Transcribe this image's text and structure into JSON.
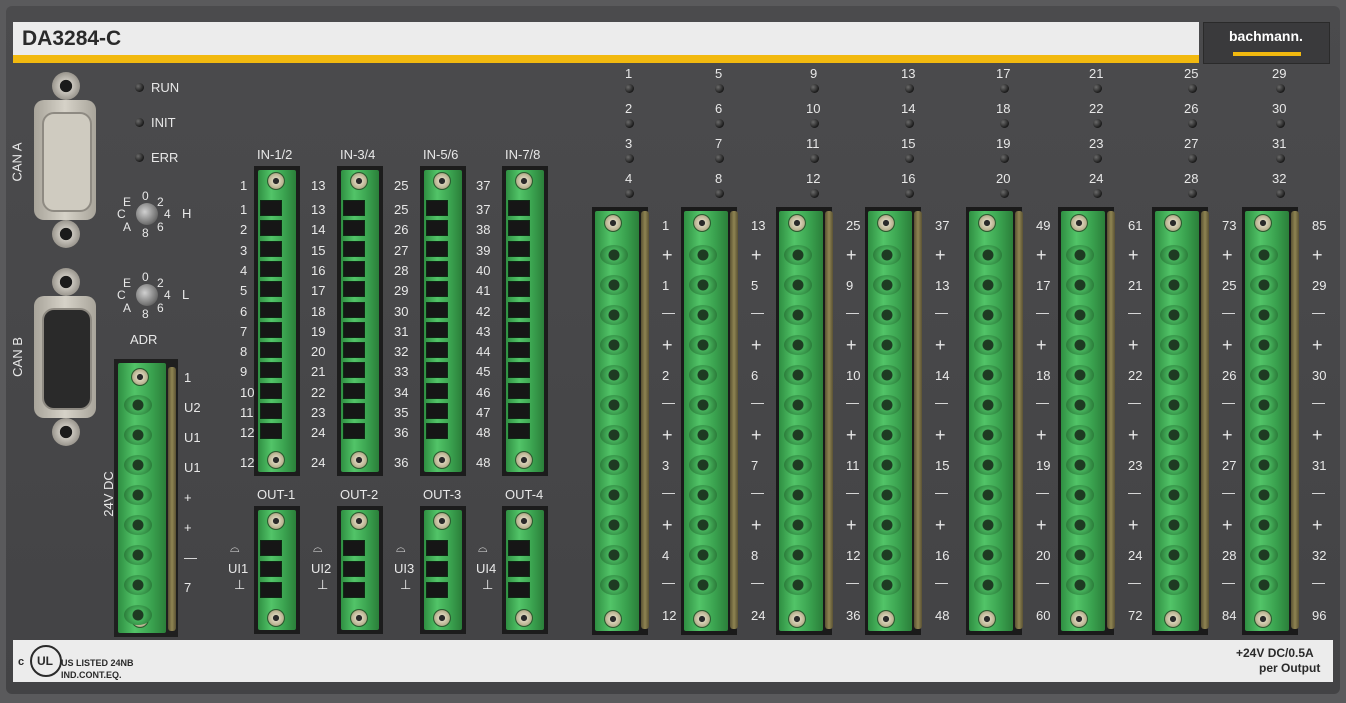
{
  "module": {
    "model": "DA3284-C",
    "brand": "bachmann.",
    "colors": {
      "accent": "#f2b90f",
      "panel": "#4a4a4c",
      "terminal": "#4dbf63",
      "label_bar": "#ececec"
    }
  },
  "status_leds": [
    "RUN",
    "INIT",
    "ERR"
  ],
  "can": {
    "a_label": "CAN A",
    "b_label": "CAN B"
  },
  "address": {
    "switch_h": {
      "top": "0",
      "right_top": "2",
      "right": "4",
      "right_bottom": "6",
      "bottom": "8",
      "left_bottom": "A",
      "left": "C",
      "left_top": "E",
      "side": "H"
    },
    "switch_l": {
      "top": "0",
      "right_top": "2",
      "right": "4",
      "right_bottom": "6",
      "bottom": "8",
      "left_bottom": "A",
      "left": "C",
      "left_top": "E",
      "side": "L"
    },
    "label": "ADR"
  },
  "power": {
    "label": "24V DC",
    "pins": [
      "1",
      "U2",
      "U1",
      "U1",
      "+",
      "+",
      "—",
      "7"
    ]
  },
  "input_groups": [
    {
      "label": "IN-1/2",
      "top": "1",
      "pins": [
        "1",
        "2",
        "3",
        "4",
        "5",
        "6",
        "7",
        "8",
        "9",
        "10",
        "11",
        "12"
      ],
      "bottom": "12"
    },
    {
      "label": "IN-3/4",
      "top": "13",
      "pins": [
        "13",
        "14",
        "15",
        "16",
        "17",
        "18",
        "19",
        "20",
        "21",
        "22",
        "23",
        "24"
      ],
      "bottom": "24"
    },
    {
      "label": "IN-5/6",
      "top": "25",
      "pins": [
        "25",
        "26",
        "27",
        "28",
        "29",
        "30",
        "31",
        "32",
        "33",
        "34",
        "35",
        "36"
      ],
      "bottom": "36"
    },
    {
      "label": "IN-7/8",
      "top": "37",
      "pins": [
        "37",
        "38",
        "39",
        "40",
        "41",
        "42",
        "43",
        "44",
        "45",
        "46",
        "47",
        "48"
      ],
      "bottom": "48"
    }
  ],
  "output_groups": [
    {
      "label": "OUT-1",
      "ui": "UI1",
      "ground": "⊥"
    },
    {
      "label": "OUT-2",
      "ui": "UI2",
      "ground": "⊥"
    },
    {
      "label": "OUT-3",
      "ui": "UI3",
      "ground": "⊥"
    },
    {
      "label": "OUT-4",
      "ui": "UI4",
      "ground": "⊥"
    }
  ],
  "output_leds": [
    [
      "1",
      "2",
      "3",
      "4"
    ],
    [
      "5",
      "6",
      "7",
      "8"
    ],
    [
      "9",
      "10",
      "11",
      "12"
    ],
    [
      "13",
      "14",
      "15",
      "16"
    ],
    [
      "17",
      "18",
      "19",
      "20"
    ],
    [
      "21",
      "22",
      "23",
      "24"
    ],
    [
      "25",
      "26",
      "27",
      "28"
    ],
    [
      "29",
      "30",
      "31",
      "32"
    ]
  ],
  "output_blocks": [
    {
      "top": "1",
      "sub": [
        "1",
        "2",
        "3",
        "4"
      ],
      "bottom": "12"
    },
    {
      "top": "13",
      "sub": [
        "5",
        "6",
        "7",
        "8"
      ],
      "bottom": "24"
    },
    {
      "top": "25",
      "sub": [
        "9",
        "10",
        "11",
        "12"
      ],
      "bottom": "36"
    },
    {
      "top": "37",
      "sub": [
        "13",
        "14",
        "15",
        "16"
      ],
      "bottom": "48"
    },
    {
      "top": "49",
      "sub": [
        "17",
        "18",
        "19",
        "20"
      ],
      "bottom": "60"
    },
    {
      "top": "61",
      "sub": [
        "21",
        "22",
        "23",
        "24"
      ],
      "bottom": "72"
    },
    {
      "top": "73",
      "sub": [
        "25",
        "26",
        "27",
        "28"
      ],
      "bottom": "84"
    },
    {
      "top": "85",
      "sub": [
        "29",
        "30",
        "31",
        "32"
      ],
      "bottom": "96"
    }
  ],
  "plus": "+",
  "minus": "—",
  "footer": {
    "ul_mark": "UL",
    "ul_c": "c",
    "ul_line1": "US LISTED 24NB",
    "ul_line2": "IND.CONT.EQ.",
    "rating_line1": "+24V DC/0.5A",
    "rating_line2": "per Output"
  }
}
